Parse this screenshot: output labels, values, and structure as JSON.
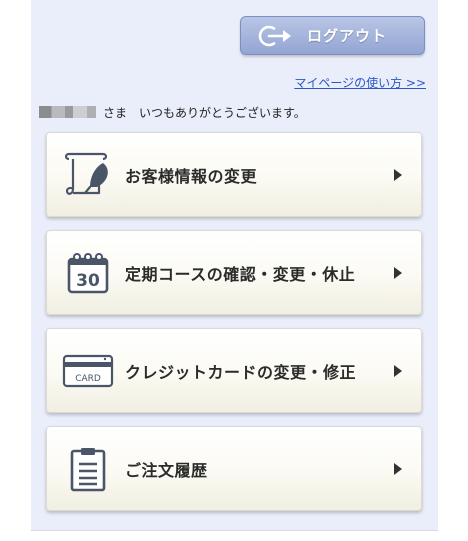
{
  "header": {
    "logout_label": "ログアウト",
    "help_link": "マイページの使い方 >>"
  },
  "greeting": {
    "suffix": "さま　いつもありがとうございます。"
  },
  "menu": {
    "items": [
      {
        "label": "お客様情報の変更",
        "icon": "edit-document-icon"
      },
      {
        "label": "定期コースの確認・変更・休止",
        "icon": "calendar-30-icon",
        "calendar_day": "30"
      },
      {
        "label": "クレジットカードの変更・修正",
        "icon": "credit-card-icon",
        "card_text": "CARD"
      },
      {
        "label": "ご注文履歴",
        "icon": "clipboard-icon"
      }
    ]
  },
  "colors": {
    "panel_bg": "#eaeefa",
    "logout_button": "#9fb0db",
    "link": "#2a57c8",
    "icon": "#4a5568"
  }
}
